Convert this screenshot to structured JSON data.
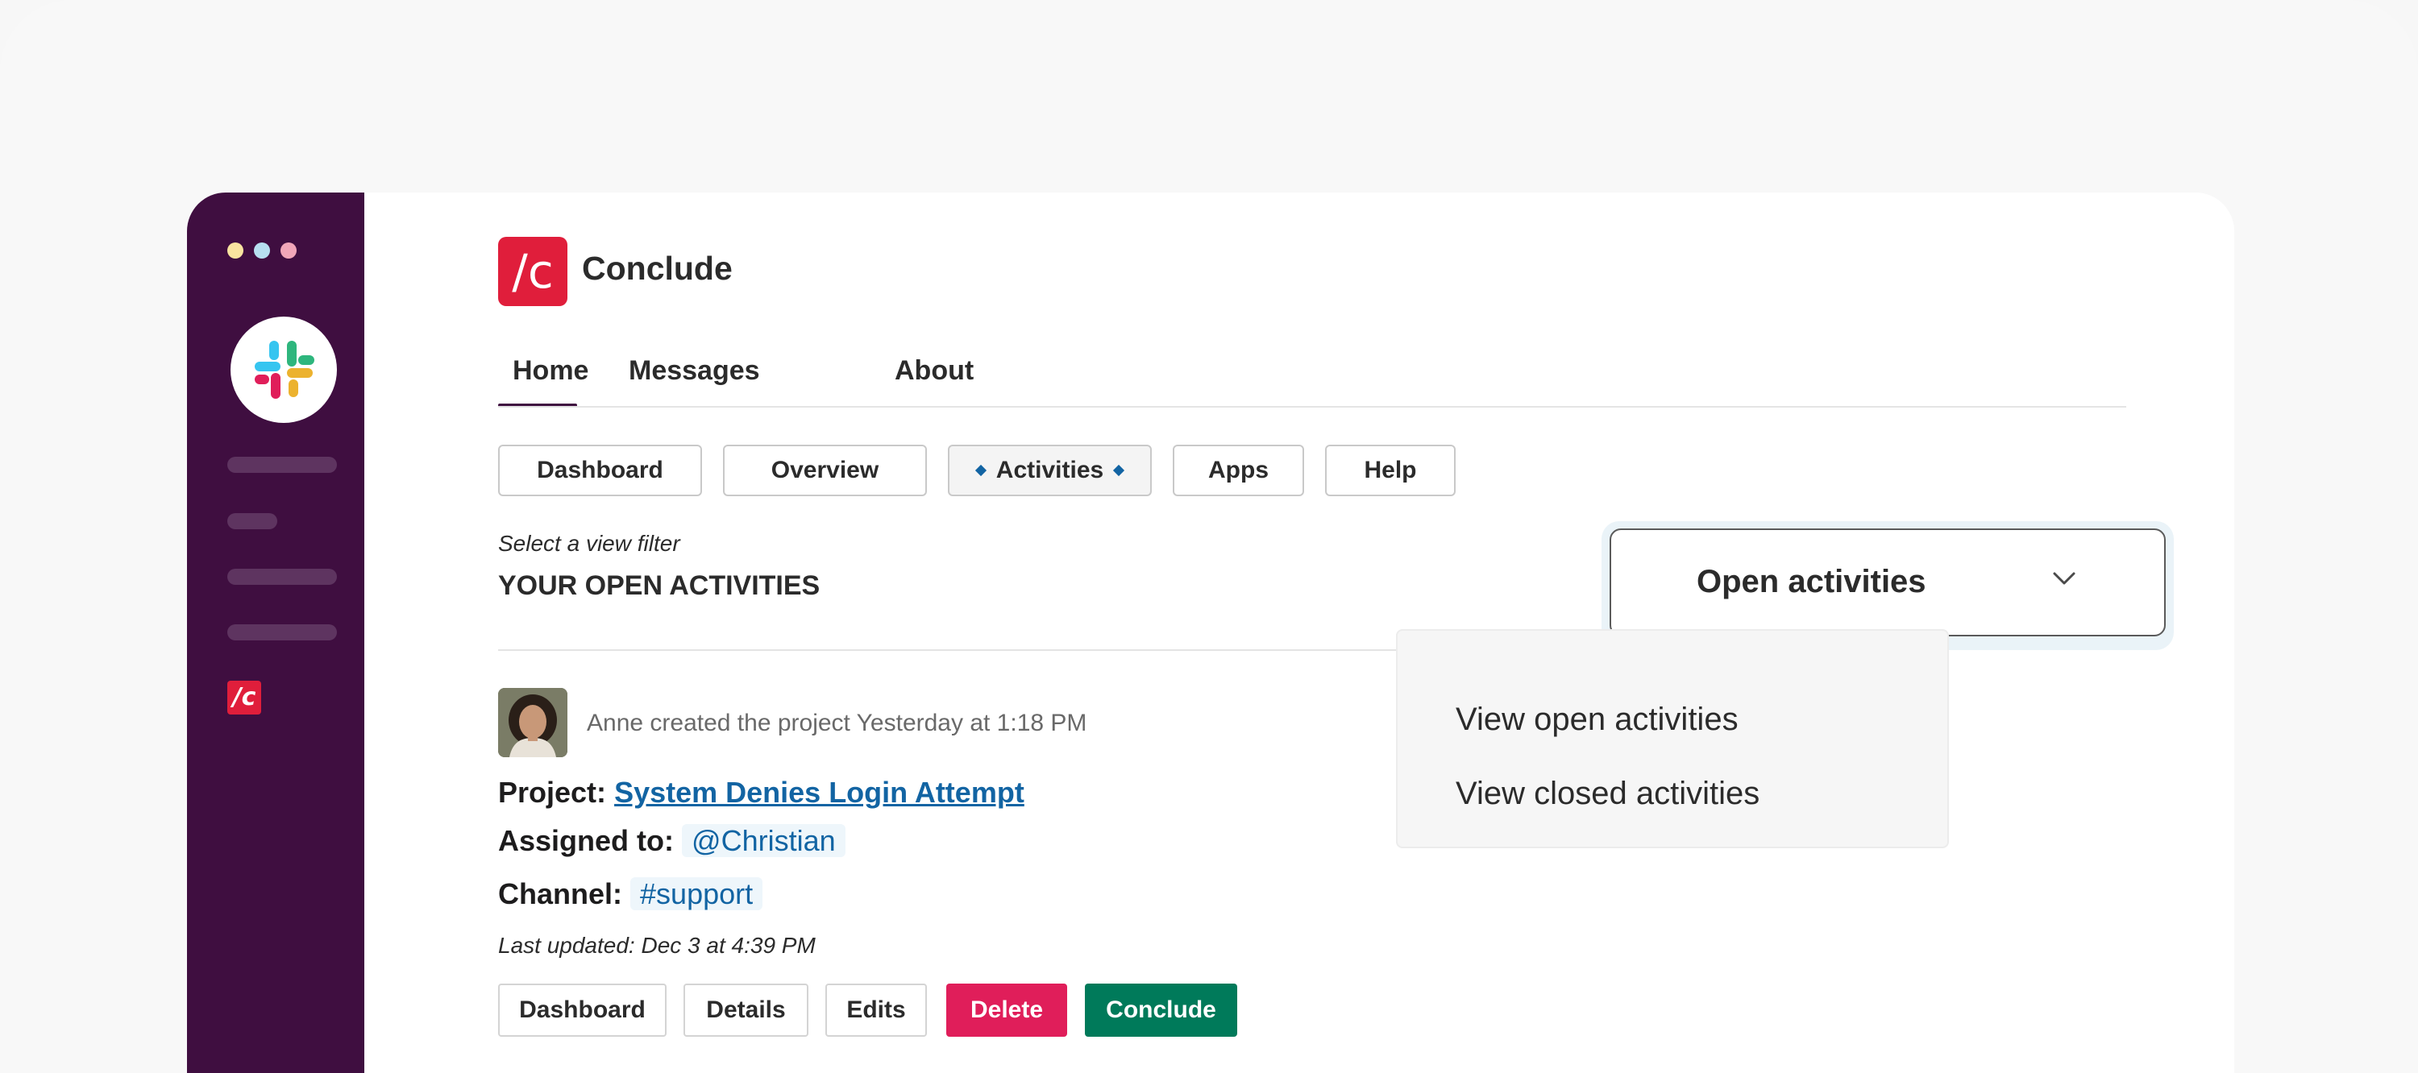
{
  "app": {
    "name": "Conclude",
    "logo_text": "/c",
    "brand_color": "#e01e3b"
  },
  "sidebar": {
    "background": "#3f0e40",
    "workspace_icon": "slack-logo-icon",
    "app_icon_text": "/c"
  },
  "tabs": [
    {
      "label": "Home",
      "active": true
    },
    {
      "label": "Messages",
      "active": false
    },
    {
      "label": "About",
      "active": false
    }
  ],
  "pills": {
    "dashboard": "Dashboard",
    "overview": "Overview",
    "activities": "Activities",
    "apps": "Apps",
    "help": "Help"
  },
  "filter": {
    "label": "Select a view filter",
    "selected": "Open activities",
    "options": [
      "View open activities",
      "View closed activities"
    ]
  },
  "section_title": "YOUR OPEN ACTIVITIES",
  "activity": {
    "meta": "Anne created the project Yesterday at 1:18 PM",
    "project_label": "Project:",
    "project_name": "System Denies Login Attempt",
    "assigned_label": "Assigned to:",
    "assigned_to": "@Christian",
    "channel_label": "Channel:",
    "channel": "#support",
    "last_updated": "Last updated: Dec 3 at 4:39 PM"
  },
  "actions": {
    "dashboard": "Dashboard",
    "details": "Details",
    "edits": "Edits",
    "delete": "Delete",
    "conclude": "Conclude",
    "delete_color": "#e01e5a",
    "conclude_color": "#007a5a"
  }
}
